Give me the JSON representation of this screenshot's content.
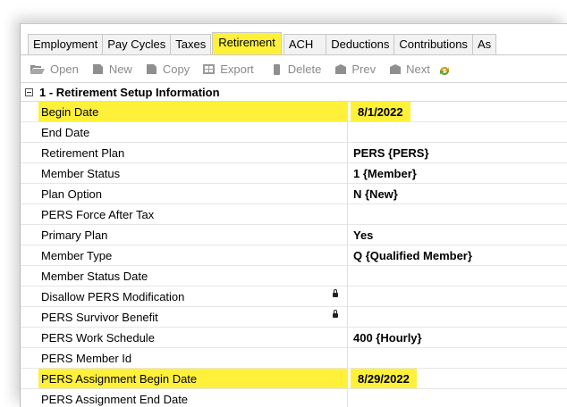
{
  "tabs": [
    "Employment",
    "Pay Cycles",
    "Taxes",
    "Retirement",
    "ACH",
    "Deductions",
    "Contributions",
    "As"
  ],
  "active_tab": "Retirement",
  "toolbar": {
    "open": "Open",
    "new": "New",
    "copy": "Copy",
    "export": "Export",
    "delete": "Delete",
    "prev": "Prev",
    "next": "Next"
  },
  "group": {
    "title": "1 - Retirement Setup Information"
  },
  "rows": [
    {
      "name": "Begin Date",
      "value": "8/1/2022"
    },
    {
      "name": "End Date",
      "value": ""
    },
    {
      "name": "Retirement Plan",
      "value": "PERS {PERS}"
    },
    {
      "name": "Member Status",
      "value": "1 {Member}"
    },
    {
      "name": "Plan Option",
      "value": "N {New}"
    },
    {
      "name": "PERS Force After Tax",
      "value": ""
    },
    {
      "name": "Primary Plan",
      "value": "Yes"
    },
    {
      "name": "Member Type",
      "value": "Q {Qualified Member}"
    },
    {
      "name": "Member Status Date",
      "value": ""
    },
    {
      "name": "Disallow PERS Modification",
      "value": ""
    },
    {
      "name": "PERS Survivor Benefit",
      "value": ""
    },
    {
      "name": "PERS Work Schedule",
      "value": "400 {Hourly}"
    },
    {
      "name": "PERS Member Id",
      "value": ""
    },
    {
      "name": "PERS Assignment Begin Date",
      "value": "8/29/2022"
    },
    {
      "name": "PERS Assignment End Date",
      "value": ""
    }
  ],
  "highlight_color": "#fff13a"
}
